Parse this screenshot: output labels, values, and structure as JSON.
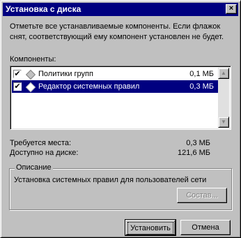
{
  "window": {
    "title": "Установка с диска",
    "close_symbol": "×"
  },
  "instructions": "Отметьте все устанавливаемые компоненты. Если флажок снят, соответствующий ему компонент установлен не будет.",
  "components": {
    "label": "Компоненты:",
    "items": [
      {
        "label": "Политики групп",
        "size": "0,1 МБ",
        "checked": true,
        "selected": false
      },
      {
        "label": "Редактор системных правил",
        "size": "0,3 МБ",
        "checked": true,
        "selected": true
      }
    ],
    "checkmark": "✔",
    "scroll_up": "▲",
    "scroll_down": "▼"
  },
  "space": {
    "required_label": "Требуется места:",
    "required_value": "0,3 МБ",
    "available_label": "Доступно на диске:",
    "available_value": "121,6 МБ"
  },
  "description": {
    "title": "Описание",
    "text": "Установка системных правил для пользователей сети",
    "details_button": "Состав..."
  },
  "buttons": {
    "install": "Установить",
    "cancel": "Отмена"
  },
  "colors": {
    "titlebar": "#000080",
    "selection": "#000080",
    "face": "#c0c0c0"
  }
}
